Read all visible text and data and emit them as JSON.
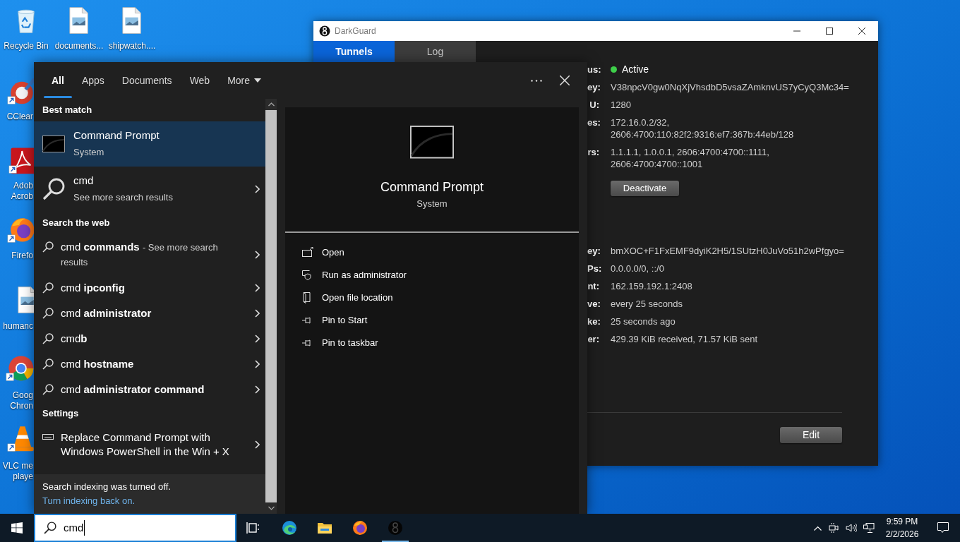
{
  "desktop_icons": [
    {
      "kind": "recycle",
      "shortcut": false,
      "label_lines": [
        "Recycle Bin"
      ]
    },
    {
      "kind": "image",
      "shortcut": false,
      "label_lines": [
        "documents..."
      ]
    },
    {
      "kind": "image",
      "shortcut": false,
      "label_lines": [
        "shipwatch...."
      ]
    },
    {
      "kind": "ccleaner",
      "shortcut": true,
      "label_lines": [
        "CClear"
      ]
    },
    {
      "kind": "pdf",
      "shortcut": true,
      "label_lines": [
        "Adob",
        "Acrob"
      ]
    },
    {
      "kind": "firefox",
      "shortcut": true,
      "label_lines": [
        "Firefo"
      ]
    },
    {
      "kind": "image",
      "shortcut": false,
      "label_lines": [
        "humanc"
      ]
    },
    {
      "kind": "chrome",
      "shortcut": true,
      "label_lines": [
        "Goog",
        "Chron"
      ]
    },
    {
      "kind": "vlc",
      "shortcut": true,
      "label_lines": [
        "VLC me",
        "playe"
      ]
    }
  ],
  "darkguard": {
    "title": "DarkGuard",
    "tabs": [
      {
        "label": "Tunnels",
        "selected": true
      },
      {
        "label": "Log",
        "selected": false
      }
    ],
    "interface_rows": [
      {
        "label": "us:",
        "kind": "status",
        "value_lines": [
          "Active"
        ]
      },
      {
        "label": "ey:",
        "kind": "text",
        "value_lines": [
          "V38npcV0gw0NqXjVhsdbD5vsaZAmknvUS7yCyQ3Mc34="
        ]
      },
      {
        "label": "U:",
        "kind": "text",
        "value_lines": [
          "1280"
        ]
      },
      {
        "label": "es:",
        "kind": "text",
        "value_lines": [
          "172.16.0.2/32,",
          "2606:4700:110:82f2:9316:ef7:367b:44eb/128"
        ]
      },
      {
        "label": "rs:",
        "kind": "text",
        "value_lines": [
          "1.1.1.1, 1.0.0.1, 2606:4700:4700::1111,",
          "2606:4700:4700::1001"
        ]
      }
    ],
    "deactivate_button": "Deactivate",
    "peer_rows": [
      {
        "label": "ey:",
        "kind": "text",
        "value_lines": [
          "bmXOC+F1FxEMF9dyiK2H5/1SUtzH0JuVo51h2wPfgyo="
        ]
      },
      {
        "label": "Ps:",
        "kind": "text",
        "value_lines": [
          "0.0.0.0/0, ::/0"
        ]
      },
      {
        "label": "nt:",
        "kind": "text",
        "value_lines": [
          "162.159.192.1:2408"
        ]
      },
      {
        "label": "ve:",
        "kind": "text",
        "value_lines": [
          "every 25 seconds"
        ]
      },
      {
        "label": "ke:",
        "kind": "text",
        "value_lines": [
          "25 seconds ago"
        ]
      },
      {
        "label": "er:",
        "kind": "text",
        "value_lines": [
          "429.39 KiB received, 71.57 KiB sent"
        ]
      }
    ],
    "edit_button": "Edit"
  },
  "search_panel": {
    "tabs": [
      {
        "label": "All",
        "kind": "plain",
        "selected": true
      },
      {
        "label": "Apps",
        "kind": "plain",
        "selected": false
      },
      {
        "label": "Documents",
        "kind": "plain",
        "selected": false
      },
      {
        "label": "Web",
        "kind": "plain",
        "selected": false
      },
      {
        "label": "More",
        "kind": "dropdown",
        "selected": false
      }
    ],
    "sections": [
      {
        "heading": "Best match",
        "items": [
          {
            "kind": "app",
            "title": "Command Prompt",
            "subtitle": "System",
            "selected": true
          },
          {
            "kind": "search",
            "title": "cmd",
            "subtitle": "See more search results",
            "selected": false
          }
        ]
      },
      {
        "heading": "Search the web",
        "items": [
          {
            "kind": "web",
            "text": "cmd **commands**",
            "note": "- See more search results",
            "selected": false
          },
          {
            "kind": "web",
            "text": "cmd **ipconfig**",
            "selected": false
          },
          {
            "kind": "web",
            "text": "cmd **administrator**",
            "selected": false
          },
          {
            "kind": "web",
            "text": "cmd**b**",
            "selected": false
          },
          {
            "kind": "web",
            "text": "cmd **hostname**",
            "selected": false
          },
          {
            "kind": "web",
            "text": "cmd **administrator command**",
            "selected": false
          }
        ]
      },
      {
        "heading": "Settings",
        "items": [
          {
            "kind": "setting",
            "text": "Replace Command Prompt with Windows PowerShell in the Win + X",
            "selected": false
          }
        ]
      }
    ],
    "preview": {
      "title": "Command Prompt",
      "subtitle": "System",
      "actions": [
        {
          "kind": "open",
          "label": "Open"
        },
        {
          "kind": "admin",
          "label": "Run as administrator"
        },
        {
          "kind": "folder",
          "label": "Open file location"
        },
        {
          "kind": "pin",
          "label": "Pin to Start"
        },
        {
          "kind": "pin",
          "label": "Pin to taskbar"
        }
      ]
    },
    "footer": {
      "message": "Search indexing was turned off.",
      "link": "Turn indexing back on."
    }
  },
  "taskbar": {
    "search_value": "cmd",
    "apps": [
      {
        "kind": "taskview",
        "open": false
      },
      {
        "kind": "edge",
        "open": false
      },
      {
        "kind": "explorer",
        "open": false
      },
      {
        "kind": "firefox",
        "open": false
      },
      {
        "kind": "darkguard",
        "open": true
      }
    ],
    "clock": {
      "time": "9:59 PM",
      "date": "2/2/2026"
    }
  }
}
